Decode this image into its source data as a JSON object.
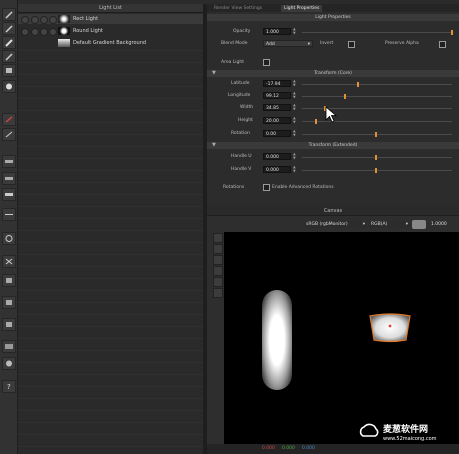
{
  "toolbar": {
    "icons": [
      "pen-icon",
      "pen-icon",
      "pen-icon",
      "brush-icon",
      "eraser-icon",
      "star-icon",
      "line-icon",
      "arrow-icon",
      "rect-icon",
      "rect-icon",
      "rect-icon",
      "gear-icon",
      "cross-icon",
      "square-icon",
      "square-icon",
      "square-icon",
      "square-icon",
      "cube-icon",
      "sphere-icon",
      "help-icon"
    ]
  },
  "light_list": {
    "title": "Light List",
    "items": [
      {
        "name": "Rect Light",
        "selected": true
      },
      {
        "name": "Round Light",
        "selected": false
      },
      {
        "name": "Default Gradient Background",
        "selected": false
      }
    ]
  },
  "properties": {
    "tabs": [
      "Render View Settings",
      "Light Properties"
    ],
    "active_tab": "Light Properties",
    "section_title": "Light Properties",
    "opacity": {
      "label": "Opacity",
      "value": "1.000"
    },
    "blend_mode": {
      "label": "Blend Mode",
      "value": "Add"
    },
    "invert": {
      "label": "Invert"
    },
    "preserve_alpha": {
      "label": "Preserve Alpha"
    },
    "area_light": {
      "label": "Area Light"
    },
    "transform_core": {
      "title": "Transform (Core)",
      "fields": [
        {
          "label": "Latitude",
          "value": "-17.94"
        },
        {
          "label": "Longitude",
          "value": "99.12"
        },
        {
          "label": "Width",
          "value": "34.85"
        },
        {
          "label": "Height",
          "value": "20.00"
        },
        {
          "label": "Rotation",
          "value": "0.00"
        }
      ]
    },
    "transform_extended": {
      "title": "Transform (Extended)",
      "fields": [
        {
          "label": "Handle U",
          "value": "0.000"
        },
        {
          "label": "Handle V",
          "value": "0.000"
        }
      ]
    },
    "rotations": {
      "label": "Rotations",
      "checkbox_label": "Enable Advanced Rotations"
    }
  },
  "canvas": {
    "title": "Canvas",
    "color_space": "sRGB (rgbMonitor)",
    "channel": "RGB(A)",
    "exposure": "1.0000"
  },
  "status": {
    "values": [
      "0.000",
      "0.000",
      "0.000"
    ]
  },
  "watermark": {
    "brand": "麦葱软件网",
    "url": "www.52maicong.com"
  },
  "colors": {
    "accent": "#e0903a",
    "selection_outline": "#e07a2a",
    "panel_bg": "#2c2c2c",
    "section_header": "#3a3a3a"
  }
}
